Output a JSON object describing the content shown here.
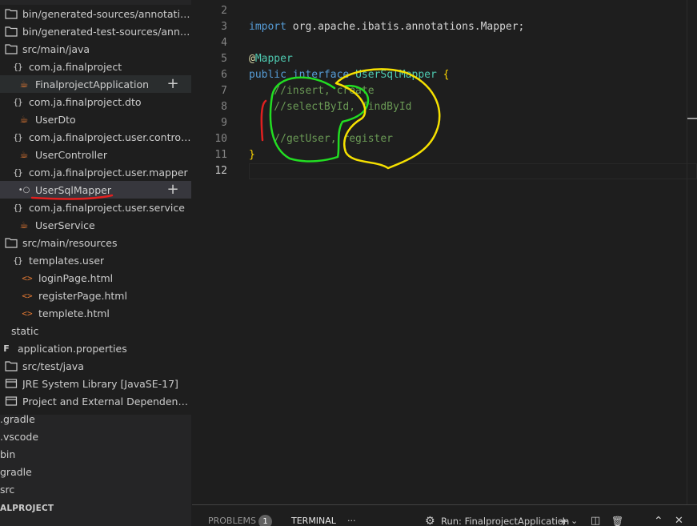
{
  "explorer": {
    "items": [
      {
        "icon": "folder-icon",
        "label": "bin/generated-sources/annotations"
      },
      {
        "icon": "folder-icon",
        "label": "bin/generated-test-sources/anno..."
      },
      {
        "icon": "folder-icon",
        "label": "src/main/java"
      },
      {
        "icon": "package-icon",
        "label": "com.ja.finalproject"
      },
      {
        "icon": "java-class-icon",
        "label": "FinalprojectApplication"
      },
      {
        "icon": "package-icon",
        "label": "com.ja.finalproject.dto"
      },
      {
        "icon": "java-class-icon",
        "label": "UserDto"
      },
      {
        "icon": "package-icon",
        "label": "com.ja.finalproject.user.controller"
      },
      {
        "icon": "java-class-icon",
        "label": "UserController"
      },
      {
        "icon": "package-icon",
        "label": "com.ja.finalproject.user.mapper"
      },
      {
        "icon": "interface-icon",
        "label": "UserSqlMapper"
      },
      {
        "icon": "package-icon",
        "label": "com.ja.finalproject.user.service"
      },
      {
        "icon": "java-class-icon",
        "label": "UserService"
      },
      {
        "icon": "folder-icon",
        "label": "src/main/resources"
      },
      {
        "icon": "package-icon",
        "label": "templates.user"
      },
      {
        "icon": "html-file-icon",
        "label": "loginPage.html"
      },
      {
        "icon": "html-file-icon",
        "label": "registerPage.html"
      },
      {
        "icon": "html-file-icon",
        "label": "templete.html"
      },
      {
        "icon": "none",
        "label": "static"
      },
      {
        "icon": "properties-file-icon",
        "label": "application.properties"
      },
      {
        "icon": "folder-icon",
        "label": "src/test/java"
      },
      {
        "icon": "library-icon",
        "label": "JRE System Library [JavaSE-17]"
      },
      {
        "icon": "library-icon",
        "label": "Project and External Dependencies"
      },
      {
        "icon": "none",
        "label": ".gradle"
      },
      {
        "icon": "none",
        "label": ".vscode"
      },
      {
        "icon": "none",
        "label": "bin"
      },
      {
        "icon": "none",
        "label": "gradle"
      },
      {
        "icon": "none",
        "label": "src"
      }
    ],
    "section_title": "ALPROJECT",
    "plus_glyph": "+"
  },
  "editor": {
    "lines": [
      {
        "n": "2"
      },
      {
        "n": "3",
        "tokens": [
          {
            "c": "kw",
            "t": "import"
          },
          {
            "c": "at",
            "t": " org.apache.ibatis.annotations.Mapper;"
          }
        ]
      },
      {
        "n": "4"
      },
      {
        "n": "5",
        "tokens": [
          {
            "c": "an",
            "t": "@"
          },
          {
            "c": "ty",
            "t": "Mapper"
          }
        ]
      },
      {
        "n": "6",
        "tokens": [
          {
            "c": "kw",
            "t": "public"
          },
          {
            "c": "at",
            "t": " "
          },
          {
            "c": "kw",
            "t": "interface"
          },
          {
            "c": "at",
            "t": " "
          },
          {
            "c": "ty",
            "t": "UserSqlMapper"
          },
          {
            "c": "at",
            "t": " "
          },
          {
            "c": "br",
            "t": "{"
          }
        ]
      },
      {
        "n": "7",
        "tokens": [
          {
            "c": "cm",
            "t": "    //insert, create"
          }
        ]
      },
      {
        "n": "8",
        "tokens": [
          {
            "c": "cm",
            "t": "    //selectById, findById"
          }
        ]
      },
      {
        "n": "9"
      },
      {
        "n": "10",
        "tokens": [
          {
            "c": "cm",
            "t": "    //getUser, register"
          }
        ]
      },
      {
        "n": "11",
        "tokens": [
          {
            "c": "br",
            "t": "}"
          }
        ]
      },
      {
        "n": "12"
      }
    ]
  },
  "panel": {
    "problems_label": "PROBLEMS",
    "problems_count": "1",
    "terminal_label": "TERMINAL",
    "more": "···",
    "run_label": "Run: FinalprojectApplication",
    "actions": [
      "+",
      "⌄",
      "◫",
      "🗑",
      "⌃",
      "✕"
    ]
  },
  "colors": {
    "annotation_green": "#22dd22",
    "annotation_yellow": "#f5e000",
    "annotation_red": "#e02020"
  }
}
